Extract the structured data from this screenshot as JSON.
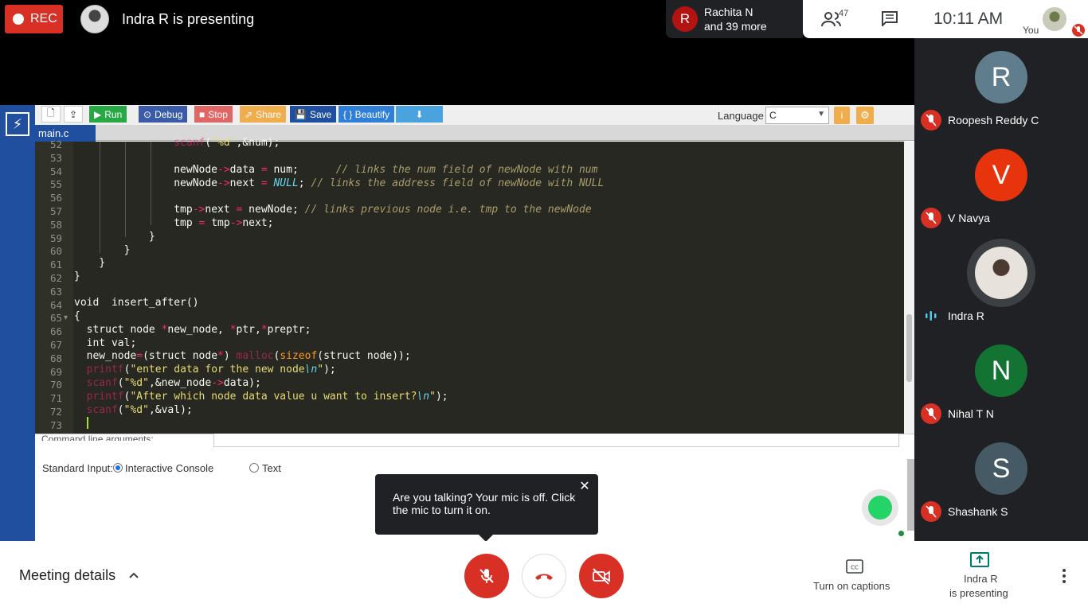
{
  "top": {
    "rec_label": "REC",
    "presenter_text": "Indra R is presenting",
    "rachita_initial": "R",
    "rachita_name": "Rachita N",
    "rachita_more": "and 39 more",
    "people_count": "47",
    "clock": "10:11 AM",
    "you_label": "You"
  },
  "ide": {
    "toolbar": [
      "Run",
      "Debug",
      "Stop",
      "Share",
      "Save",
      "{ } Beautify"
    ],
    "language_label": "Language",
    "language_value": "C",
    "tab": "main.c",
    "cmdline_label": "Command line arguments:",
    "stdin_label": "Standard Input:",
    "opt_console": "Interactive Console",
    "opt_text": "Text",
    "line_numbers": [
      "52",
      "53",
      "54",
      "55",
      "56",
      "57",
      "58",
      "59",
      "60",
      "61",
      "62",
      "63",
      "64",
      "65",
      "66",
      "67",
      "68",
      "69",
      "70",
      "71",
      "72",
      "73"
    ]
  },
  "tooltip": "Are you talking? Your mic is off. Click the mic to turn it on.",
  "participants": [
    {
      "initial": "R",
      "name": "Roopesh Reddy C",
      "color": "#5f7d8c"
    },
    {
      "initial": "V",
      "name": "V Navya",
      "color": "#e8340c"
    },
    {
      "initial": "",
      "name": "Indra R",
      "color": "#3c4043"
    },
    {
      "initial": "N",
      "name": "Nihal T N",
      "color": "#137333"
    },
    {
      "initial": "S",
      "name": "Shashank S",
      "color": "#455a64"
    }
  ],
  "bottom": {
    "meeting_details": "Meeting details",
    "captions": "Turn on captions",
    "present_line1": "Indra R",
    "present_line2": "is presenting"
  }
}
